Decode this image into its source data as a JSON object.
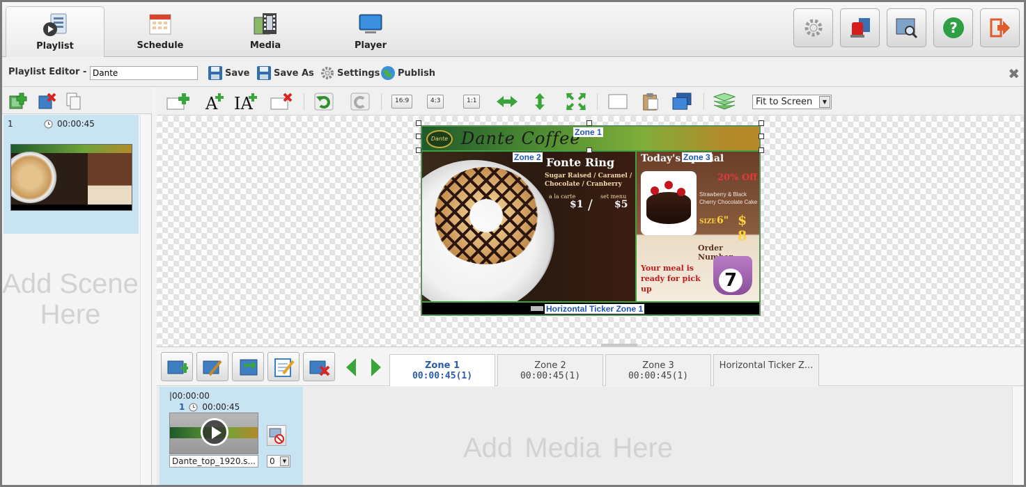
{
  "nav": {
    "tabs": [
      {
        "label": "Playlist",
        "icon": "playlist-icon",
        "active": true
      },
      {
        "label": "Schedule",
        "icon": "calendar-icon",
        "active": false
      },
      {
        "label": "Media",
        "icon": "media-icon",
        "active": false
      },
      {
        "label": "Player",
        "icon": "monitor-icon",
        "active": false
      }
    ],
    "right_buttons": [
      "settings-icon",
      "alarm-icon",
      "search-display-icon",
      "help-icon",
      "logout-icon"
    ]
  },
  "editor": {
    "title": "Playlist Editor -",
    "playlist_name": "Dante",
    "actions": {
      "save": "Save",
      "save_as": "Save As",
      "settings": "Settings",
      "publish": "Publish"
    }
  },
  "scenes": {
    "items": [
      {
        "number": "1",
        "duration": "00:00:45"
      }
    ],
    "add_hint": "Add Scene Here"
  },
  "canvas_toolbar": {
    "ratios": [
      "16:9",
      "4:3",
      "1:1"
    ],
    "fit_select": "Fit to Screen"
  },
  "design": {
    "brand_text": "Dante Coffee",
    "logo_text": "Dante",
    "zones": {
      "zone1": "Zone 1",
      "zone2": "Zone 2",
      "zone3": "Zone 3",
      "ticker": "Horizontal Ticker Zone 1"
    },
    "product": {
      "name": "Fonte Ring",
      "flavors": "Sugar Raised / Caramel / Chocolate / Cranberry",
      "a_la_carte": "a la carte",
      "set_menu": "set menu",
      "price_single": "$1",
      "price_set": "$5"
    },
    "special": {
      "heading": "Today's Special",
      "discount": "20% Off",
      "cake_name": "Strawberry & Black Cherry Chocolate Cake",
      "size_label": "SIZE",
      "size_value": "6\"",
      "price": "$ 8",
      "order_label": "Order Number",
      "order_text": "Your meal is ready for pick up",
      "order_number": "7"
    }
  },
  "zone_tabs": [
    {
      "name": "Zone 1",
      "duration": "00:00:45(1)",
      "active": true
    },
    {
      "name": "Zone 2",
      "duration": "00:00:45(1)",
      "active": false
    },
    {
      "name": "Zone 3",
      "duration": "00:00:45(1)",
      "active": false
    },
    {
      "name": "Horizontal Ticker Z...",
      "duration": "",
      "active": false
    }
  ],
  "timeline": {
    "start_time": "|00:00:00",
    "media": [
      {
        "index": "1",
        "duration": "00:00:45",
        "filename": "Dante_top_1920.s...",
        "repeat": "0"
      }
    ],
    "add_hint": "Add Media Here"
  }
}
